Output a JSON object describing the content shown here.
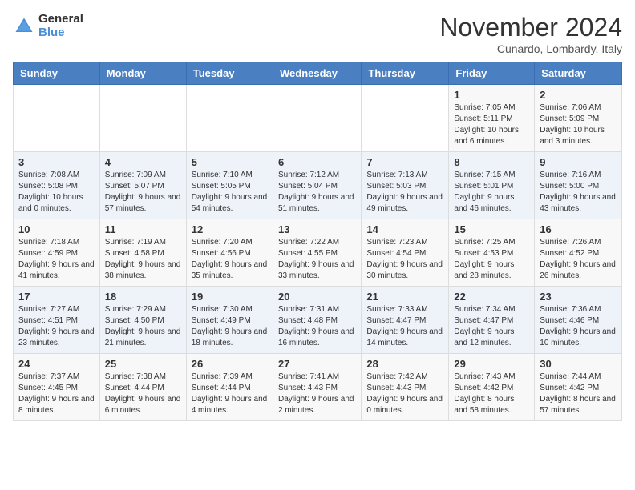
{
  "logo": {
    "line1": "General",
    "line2": "Blue"
  },
  "title": "November 2024",
  "location": "Cunardo, Lombardy, Italy",
  "days_of_week": [
    "Sunday",
    "Monday",
    "Tuesday",
    "Wednesday",
    "Thursday",
    "Friday",
    "Saturday"
  ],
  "weeks": [
    [
      {
        "day": "",
        "info": ""
      },
      {
        "day": "",
        "info": ""
      },
      {
        "day": "",
        "info": ""
      },
      {
        "day": "",
        "info": ""
      },
      {
        "day": "",
        "info": ""
      },
      {
        "day": "1",
        "info": "Sunrise: 7:05 AM\nSunset: 5:11 PM\nDaylight: 10 hours and 6 minutes."
      },
      {
        "day": "2",
        "info": "Sunrise: 7:06 AM\nSunset: 5:09 PM\nDaylight: 10 hours and 3 minutes."
      }
    ],
    [
      {
        "day": "3",
        "info": "Sunrise: 7:08 AM\nSunset: 5:08 PM\nDaylight: 10 hours and 0 minutes."
      },
      {
        "day": "4",
        "info": "Sunrise: 7:09 AM\nSunset: 5:07 PM\nDaylight: 9 hours and 57 minutes."
      },
      {
        "day": "5",
        "info": "Sunrise: 7:10 AM\nSunset: 5:05 PM\nDaylight: 9 hours and 54 minutes."
      },
      {
        "day": "6",
        "info": "Sunrise: 7:12 AM\nSunset: 5:04 PM\nDaylight: 9 hours and 51 minutes."
      },
      {
        "day": "7",
        "info": "Sunrise: 7:13 AM\nSunset: 5:03 PM\nDaylight: 9 hours and 49 minutes."
      },
      {
        "day": "8",
        "info": "Sunrise: 7:15 AM\nSunset: 5:01 PM\nDaylight: 9 hours and 46 minutes."
      },
      {
        "day": "9",
        "info": "Sunrise: 7:16 AM\nSunset: 5:00 PM\nDaylight: 9 hours and 43 minutes."
      }
    ],
    [
      {
        "day": "10",
        "info": "Sunrise: 7:18 AM\nSunset: 4:59 PM\nDaylight: 9 hours and 41 minutes."
      },
      {
        "day": "11",
        "info": "Sunrise: 7:19 AM\nSunset: 4:58 PM\nDaylight: 9 hours and 38 minutes."
      },
      {
        "day": "12",
        "info": "Sunrise: 7:20 AM\nSunset: 4:56 PM\nDaylight: 9 hours and 35 minutes."
      },
      {
        "day": "13",
        "info": "Sunrise: 7:22 AM\nSunset: 4:55 PM\nDaylight: 9 hours and 33 minutes."
      },
      {
        "day": "14",
        "info": "Sunrise: 7:23 AM\nSunset: 4:54 PM\nDaylight: 9 hours and 30 minutes."
      },
      {
        "day": "15",
        "info": "Sunrise: 7:25 AM\nSunset: 4:53 PM\nDaylight: 9 hours and 28 minutes."
      },
      {
        "day": "16",
        "info": "Sunrise: 7:26 AM\nSunset: 4:52 PM\nDaylight: 9 hours and 26 minutes."
      }
    ],
    [
      {
        "day": "17",
        "info": "Sunrise: 7:27 AM\nSunset: 4:51 PM\nDaylight: 9 hours and 23 minutes."
      },
      {
        "day": "18",
        "info": "Sunrise: 7:29 AM\nSunset: 4:50 PM\nDaylight: 9 hours and 21 minutes."
      },
      {
        "day": "19",
        "info": "Sunrise: 7:30 AM\nSunset: 4:49 PM\nDaylight: 9 hours and 18 minutes."
      },
      {
        "day": "20",
        "info": "Sunrise: 7:31 AM\nSunset: 4:48 PM\nDaylight: 9 hours and 16 minutes."
      },
      {
        "day": "21",
        "info": "Sunrise: 7:33 AM\nSunset: 4:47 PM\nDaylight: 9 hours and 14 minutes."
      },
      {
        "day": "22",
        "info": "Sunrise: 7:34 AM\nSunset: 4:47 PM\nDaylight: 9 hours and 12 minutes."
      },
      {
        "day": "23",
        "info": "Sunrise: 7:36 AM\nSunset: 4:46 PM\nDaylight: 9 hours and 10 minutes."
      }
    ],
    [
      {
        "day": "24",
        "info": "Sunrise: 7:37 AM\nSunset: 4:45 PM\nDaylight: 9 hours and 8 minutes."
      },
      {
        "day": "25",
        "info": "Sunrise: 7:38 AM\nSunset: 4:44 PM\nDaylight: 9 hours and 6 minutes."
      },
      {
        "day": "26",
        "info": "Sunrise: 7:39 AM\nSunset: 4:44 PM\nDaylight: 9 hours and 4 minutes."
      },
      {
        "day": "27",
        "info": "Sunrise: 7:41 AM\nSunset: 4:43 PM\nDaylight: 9 hours and 2 minutes."
      },
      {
        "day": "28",
        "info": "Sunrise: 7:42 AM\nSunset: 4:43 PM\nDaylight: 9 hours and 0 minutes."
      },
      {
        "day": "29",
        "info": "Sunrise: 7:43 AM\nSunset: 4:42 PM\nDaylight: 8 hours and 58 minutes."
      },
      {
        "day": "30",
        "info": "Sunrise: 7:44 AM\nSunset: 4:42 PM\nDaylight: 8 hours and 57 minutes."
      }
    ]
  ]
}
